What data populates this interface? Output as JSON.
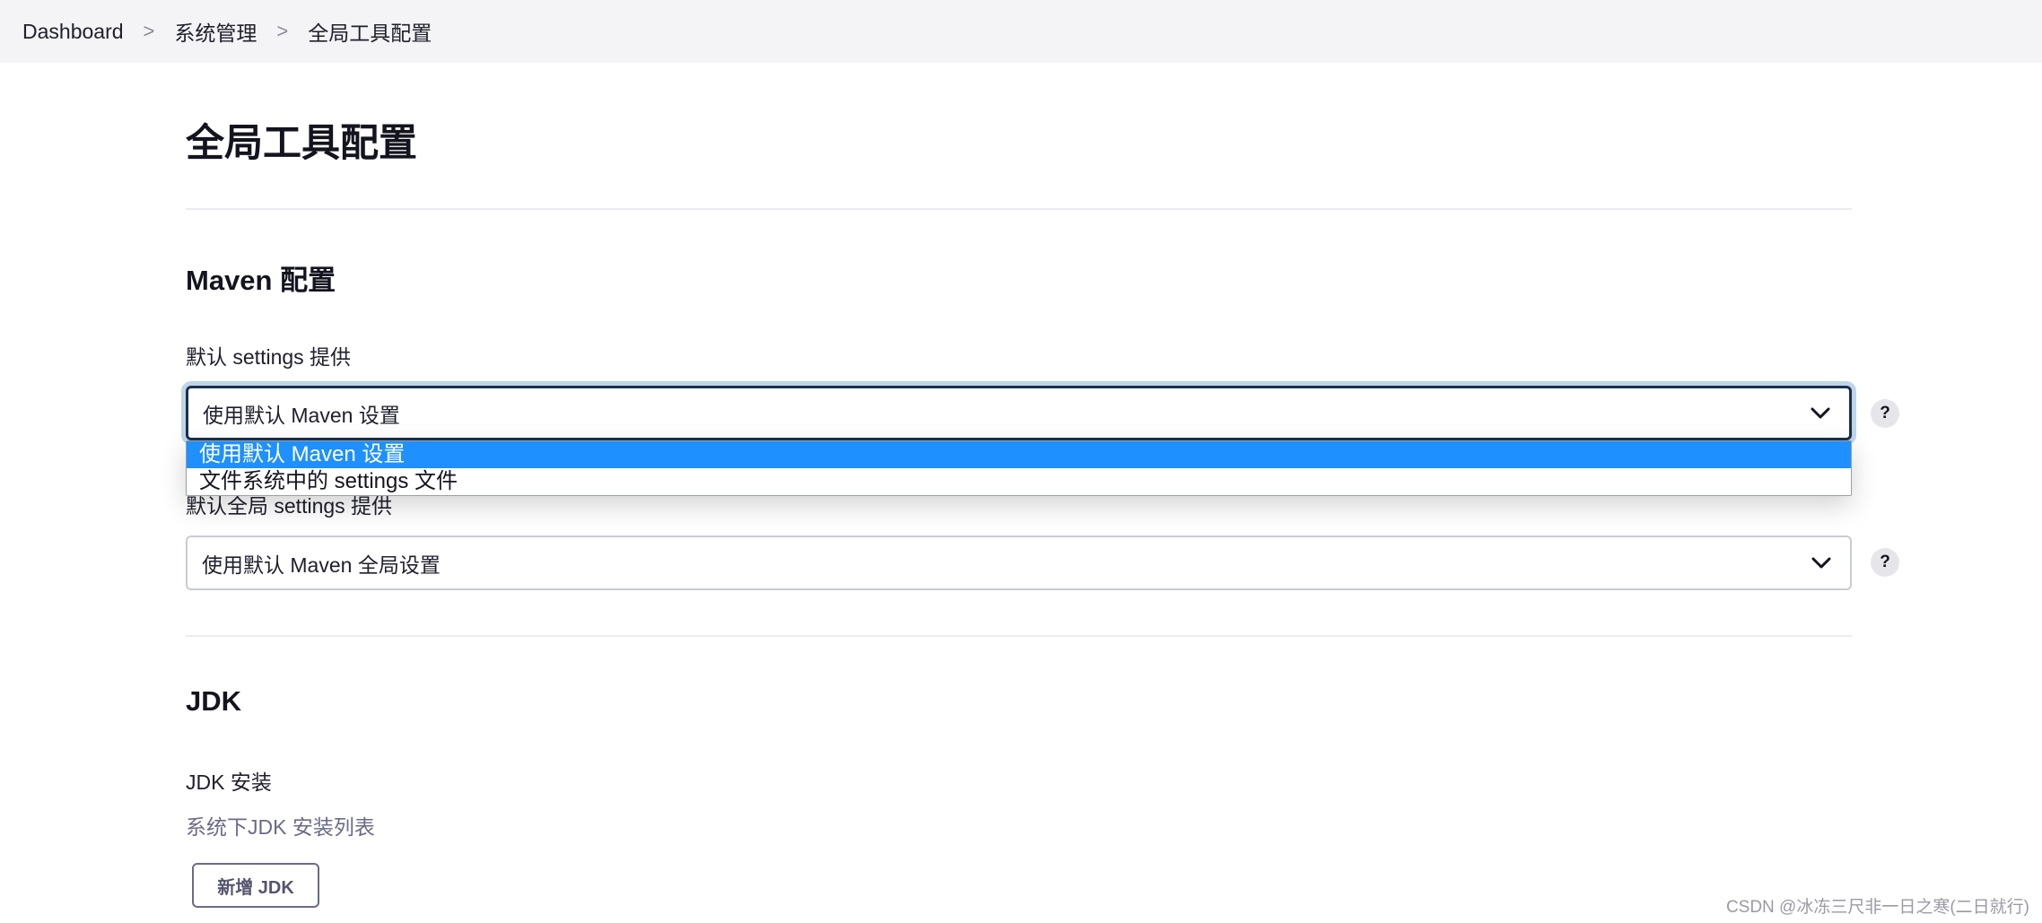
{
  "breadcrumb": {
    "items": [
      "Dashboard",
      "系统管理",
      "全局工具配置"
    ],
    "separator": ">"
  },
  "page": {
    "title": "全局工具配置"
  },
  "maven": {
    "title": "Maven 配置",
    "settings": {
      "label": "默认 settings 提供",
      "value": "使用默认 Maven 设置",
      "options": [
        "使用默认 Maven 设置",
        "文件系统中的 settings 文件"
      ]
    },
    "global_settings": {
      "label": "默认全局 settings 提供",
      "value": "使用默认 Maven 全局设置"
    }
  },
  "jdk": {
    "title": "JDK",
    "install_label": "JDK 安装",
    "description": "系统下JDK 安装列表",
    "add_button": "新增 JDK"
  },
  "help_label": "?",
  "watermark": "CSDN @冰冻三尺非一日之寒(二日就行)",
  "colors": {
    "accent": "#1e90ff",
    "focus_border": "#1c2f4a",
    "focus_ring": "#bed5ea",
    "topbar_bg": "#f4f4f6"
  }
}
